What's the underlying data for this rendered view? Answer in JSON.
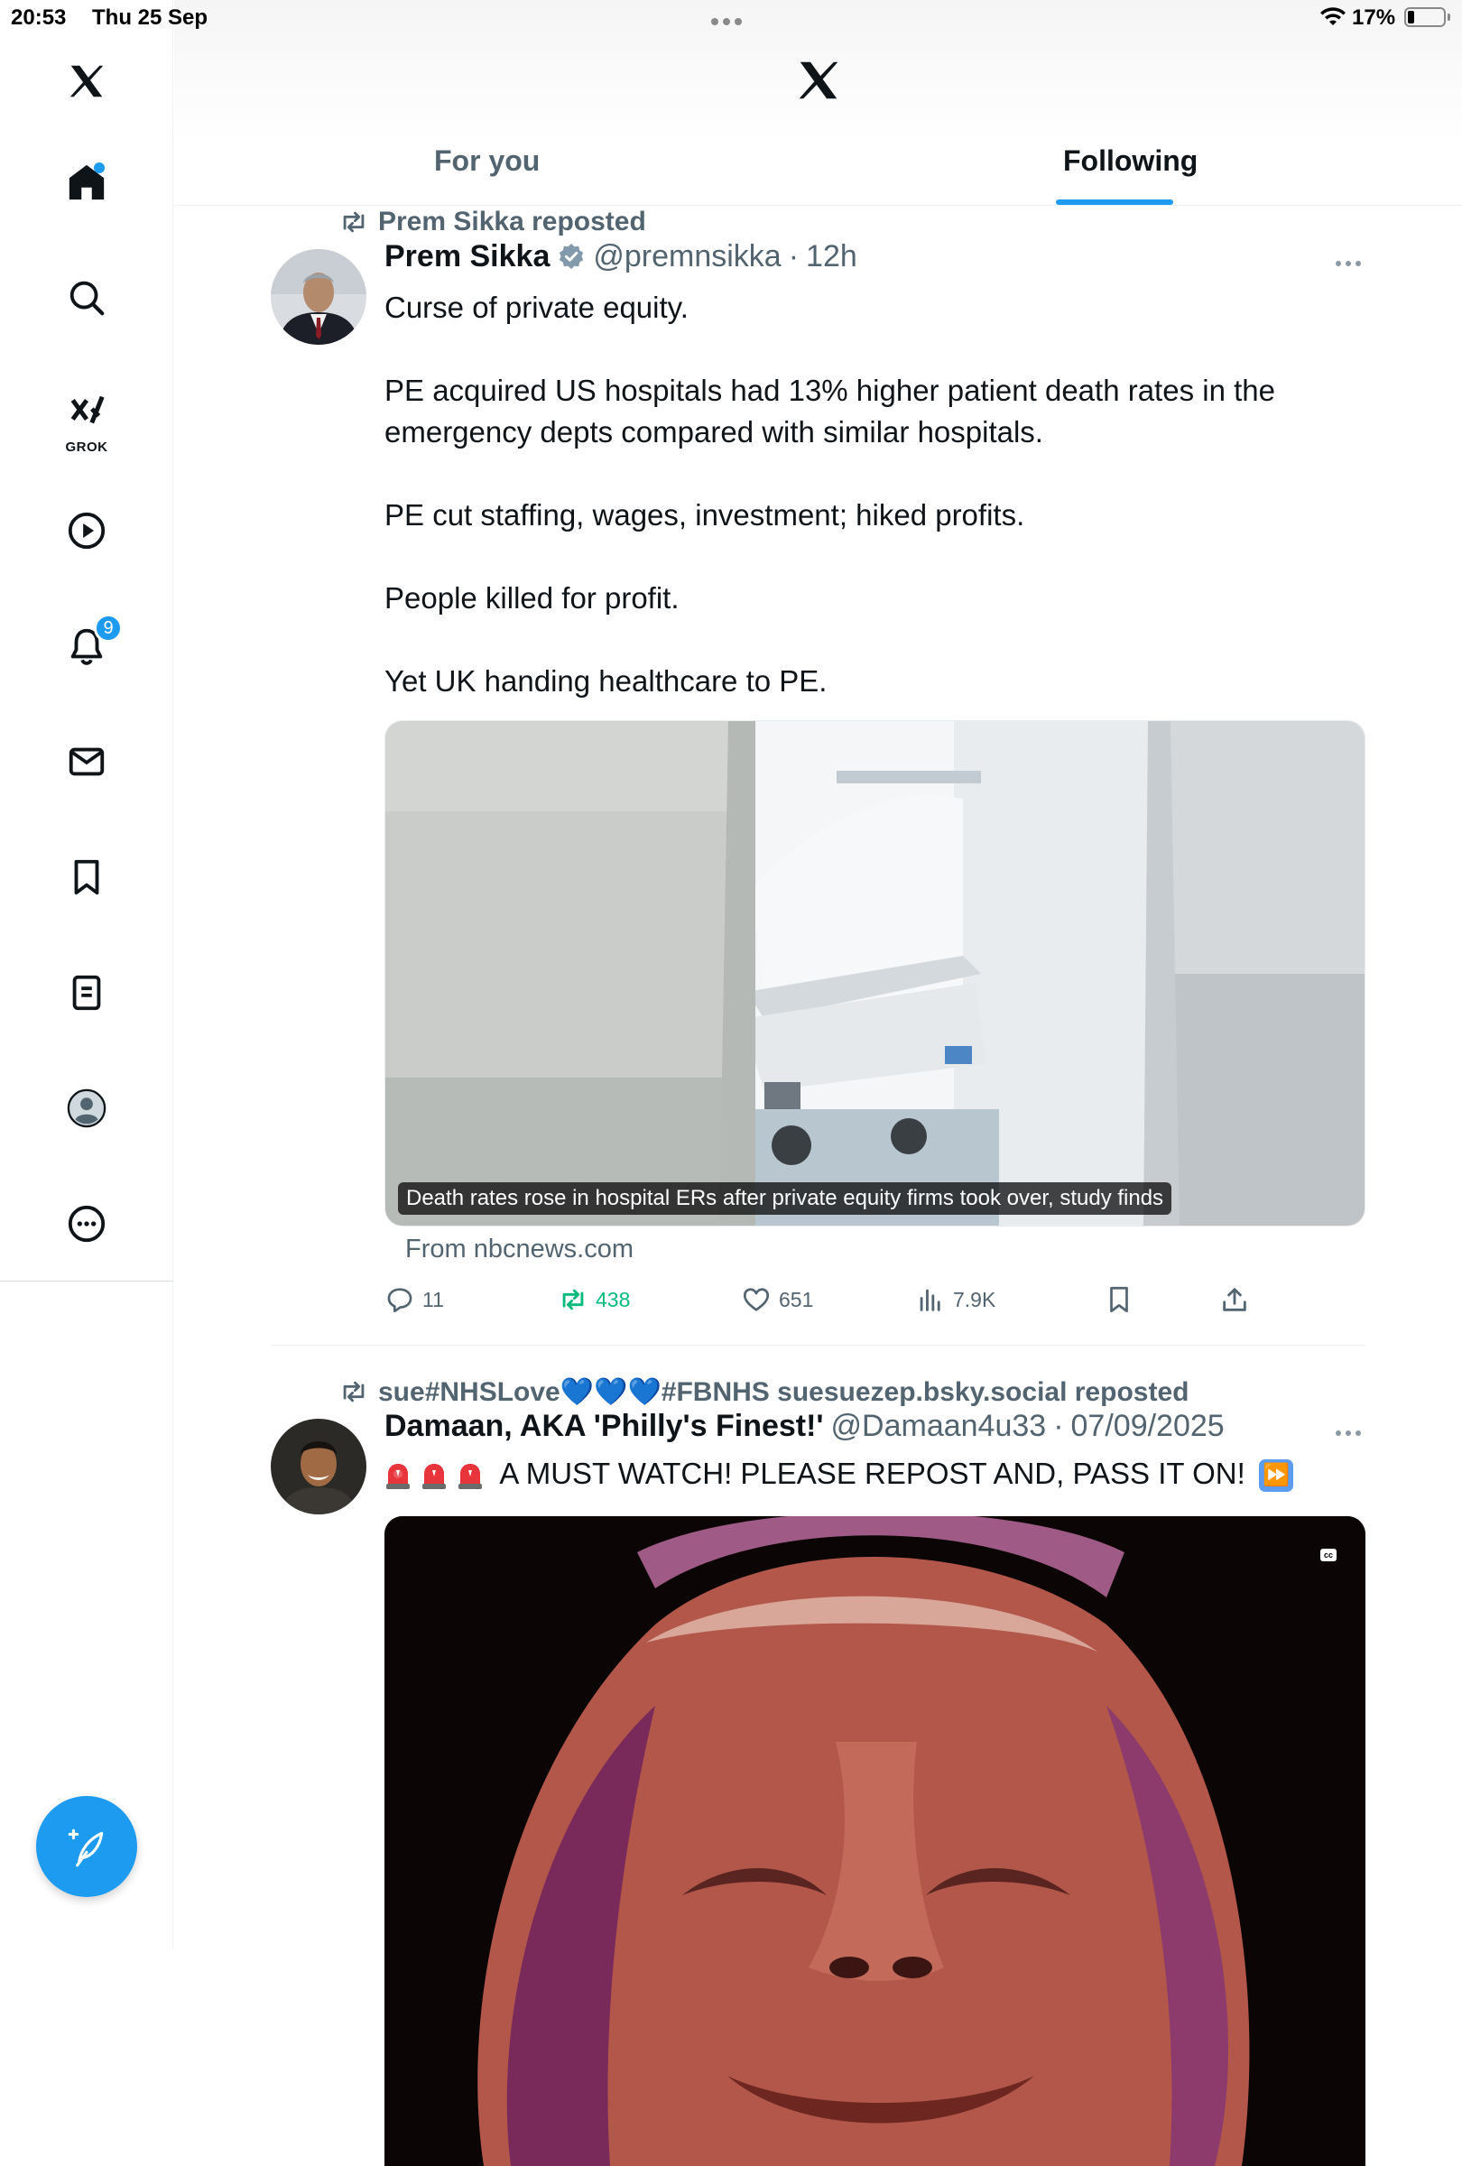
{
  "status_bar": {
    "time": "20:53",
    "date": "Thu 25 Sep",
    "battery_percent_label": "17%",
    "battery_level": 0.17
  },
  "sidebar": {
    "items": [
      {
        "icon": "x-logo-icon"
      },
      {
        "icon": "home-icon",
        "unread_dot": true
      },
      {
        "icon": "search-icon"
      },
      {
        "icon": "grok-icon",
        "label": "GROK"
      },
      {
        "icon": "video-play-icon"
      },
      {
        "icon": "notifications-icon",
        "badge": "9"
      },
      {
        "icon": "messages-icon"
      },
      {
        "icon": "bookmarks-icon"
      },
      {
        "icon": "lists-icon"
      },
      {
        "icon": "profile-avatar-icon"
      },
      {
        "icon": "more-icon"
      }
    ],
    "compose_icon": "compose-feather-icon"
  },
  "header": {
    "tabs": [
      {
        "label": "For you",
        "active": false
      },
      {
        "label": "Following",
        "active": true
      }
    ]
  },
  "colors": {
    "accent": "#1d9bf0",
    "text_primary": "#0f1419",
    "text_secondary": "#536471",
    "retweet_active": "#00ba7c"
  },
  "posts": [
    {
      "repost_by": "Prem Sikka reposted",
      "author": "Prem Sikka",
      "verified": true,
      "handle": "@premnsikka",
      "separator": "·",
      "time": "12h",
      "text": [
        "Curse of private equity.",
        "PE acquired US hospitals had 13% higher patient death rates in the emergency depts compared with similar hospitals.",
        "PE cut staffing, wages, investment; hiked profits.",
        "People killed for profit.",
        "Yet UK handing healthcare to PE."
      ],
      "card": {
        "caption": "Death rates rose in hospital ERs after private equity firms took over, study finds",
        "source": "From nbcnews.com"
      },
      "actions": {
        "replies": "11",
        "reposts": "438",
        "likes": "651",
        "views": "7.9K"
      }
    },
    {
      "repost_by": "sue#NHSLove💙💙💙#FBNHS suesuezep.bsky.social reposted",
      "author": "Damaan, AKA 'Philly's Finest!'",
      "handle": "@Damaan4u33",
      "separator": "·",
      "time": "07/09/2025",
      "text": "A MUST WATCH!  PLEASE REPOST AND, PASS IT ON!",
      "video": {
        "cc_label": "cc"
      }
    }
  ]
}
